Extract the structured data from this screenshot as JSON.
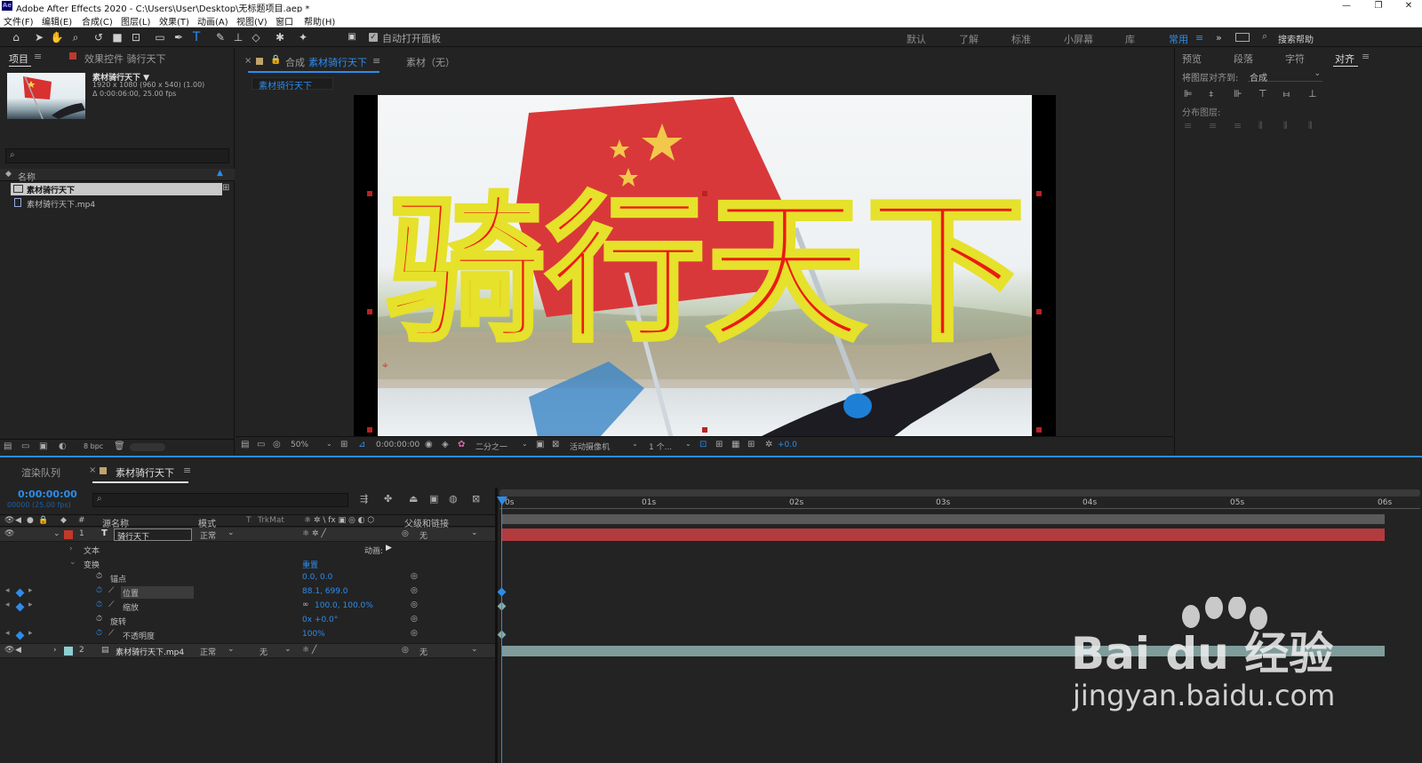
{
  "window": {
    "app_icon": "Ae",
    "title": "Adobe After Effects 2020 - C:\\Users\\User\\Desktop\\无标题项目.aep *",
    "controls": [
      "—",
      "❐",
      "✕"
    ]
  },
  "menu": [
    "文件(F)",
    "编辑(E)",
    "合成(C)",
    "图层(L)",
    "效果(T)",
    "动画(A)",
    "视图(V)",
    "窗口",
    "帮助(H)"
  ],
  "toolbar": {
    "auto_open_label": "自动打开面板",
    "workspaces": [
      "默认",
      "了解",
      "标准",
      "小屏幕",
      "库",
      "常用"
    ],
    "active_workspace": "常用",
    "search_placeholder": "搜索帮助"
  },
  "project_panel": {
    "tab_project": "项目",
    "tab_effects": "效果控件 骑行天下",
    "item_name": "素材骑行天下 ▼",
    "item_info1": "1920 x 1080  (960 x 540) (1.00)",
    "item_info2": "Δ 0:00:06:00, 25.00 fps",
    "search_placeholder": "",
    "col_name": "名称",
    "items": [
      "素材骑行天下",
      "素材骑行天下.mp4"
    ],
    "bpc": "8 bpc"
  },
  "comp_panel": {
    "tab_label": "合成",
    "comp_name": "素材骑行天下",
    "material_label": "素材（无）",
    "breadcrumb": "素材骑行天下",
    "overlay_text": "骑行天下",
    "zoom": "50%",
    "timecode": "0:00:00:00",
    "resolution": "二分之一",
    "camera": "活动摄像机",
    "views": "1 个...",
    "exposure": "+0.0"
  },
  "right_panel": {
    "tabs": [
      "预览",
      "段落",
      "字符",
      "对齐"
    ],
    "align_to_label": "将图层对齐到:",
    "align_to_value": "合成",
    "distribute_label": "分布图层:"
  },
  "timeline": {
    "tab_render": "渲染队列",
    "tab_comp": "素材骑行天下",
    "timecode": "0:00:00:00",
    "frame_info": "00000 (25.00 fps)",
    "headers": {
      "source_name": "源名称",
      "mode": "模式",
      "t": "T",
      "trkmat": "TrkMat",
      "parent": "父级和链接",
      "hash": "#"
    },
    "ruler": [
      "0s",
      "01s",
      "02s",
      "03s",
      "04s",
      "05s",
      "06s"
    ],
    "layers": [
      {
        "num": "1",
        "name": "骑行天下",
        "mode": "正常",
        "parent": "无",
        "type": "T",
        "label_color": "#c0392b"
      },
      {
        "num": "2",
        "name": "素材骑行天下.mp4",
        "mode": "正常",
        "trkmat": "无",
        "parent": "无",
        "label_color": "#8ecfd1"
      }
    ],
    "text_group": "文本",
    "animate_label": "动画:",
    "transform_group": "变换",
    "reset_label": "重置",
    "props": [
      {
        "name": "锚点",
        "value": "0.0, 0.0"
      },
      {
        "name": "位置",
        "value": "88.1, 699.0"
      },
      {
        "name": "缩放",
        "value": "100.0, 100.0%"
      },
      {
        "name": "旋转",
        "value": "0x +0.0°"
      },
      {
        "name": "不透明度",
        "value": "100%"
      }
    ]
  },
  "watermark": {
    "brand": "Bai du 经验",
    "url": "jingyan.baidu.com"
  }
}
